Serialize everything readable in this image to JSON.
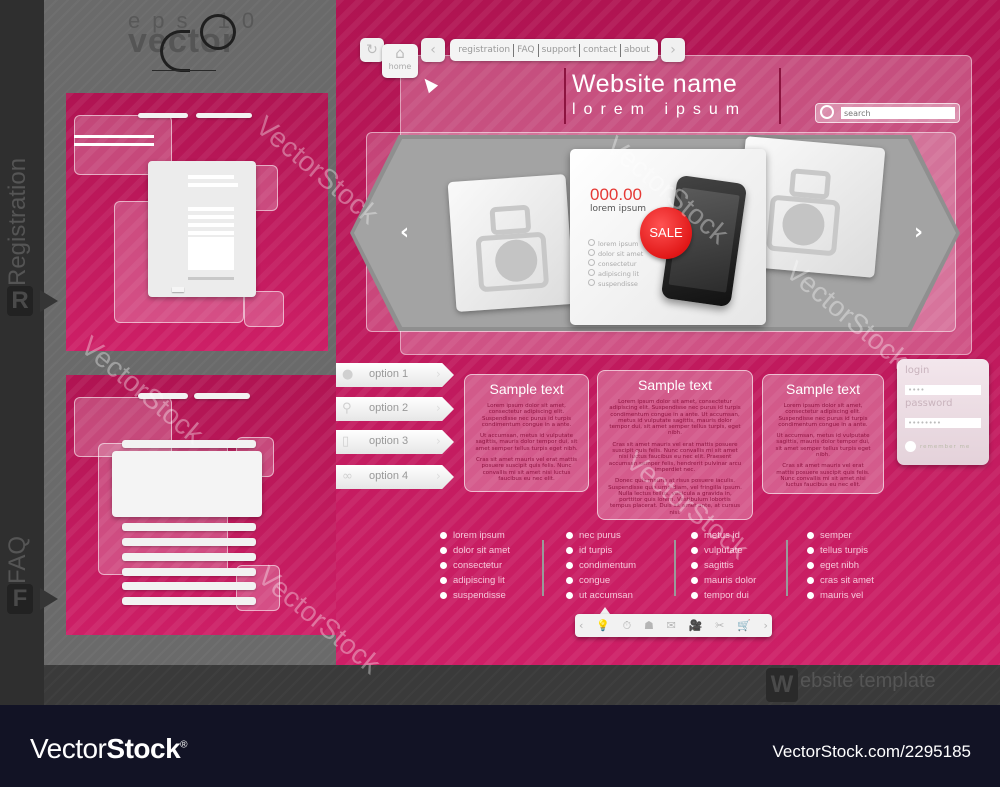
{
  "brand": {
    "eps_label": "eps 10",
    "vector_label": "vector"
  },
  "side_labels": {
    "registration": "Registration",
    "registration_initial": "R",
    "faq": "FAQ",
    "faq_initial": "F"
  },
  "nav": {
    "refresh_icon": "refresh-icon",
    "home_label": "home",
    "prev_icon": "chevron-left-icon",
    "next_icon": "chevron-right-icon",
    "links": [
      "registration",
      "FAQ",
      "support",
      "contact",
      "about"
    ]
  },
  "header": {
    "site_name": "Website name",
    "tagline": "lorem ipsum"
  },
  "search": {
    "placeholder": "search"
  },
  "slider": {
    "prev_label": "‹",
    "next_label": "›",
    "product": {
      "price": "000.00",
      "label": "lorem ipsum",
      "badge": "SALE",
      "features": [
        "lorem ipsum",
        "dolor sit amet",
        "consectetur",
        "adipiscing lit",
        "suspendisse"
      ]
    }
  },
  "options": [
    {
      "label": "option 1",
      "icon": "user-icon"
    },
    {
      "label": "option 2",
      "icon": "runner-icon"
    },
    {
      "label": "option 3",
      "icon": "phone-icon"
    },
    {
      "label": "option 4",
      "icon": "handshake-icon"
    }
  ],
  "sample_boxes": [
    {
      "title": "Sample text",
      "paragraphs": [
        "Lorem ipsum dolor sit amet, consectetur adipiscing elit. Suspendisse nec purus id turpis condimentum congue in a ante.",
        "Ut accumsan, metus id vulputate sagittis, mauris dolor tempor dui, sit amet semper tellus turpis eget nibh.",
        "Cras sit amet mauris vel erat mattis posuere suscipit quis felis. Nunc convallis mi sit amet nisi luctus faucibus eu nec elit."
      ]
    },
    {
      "title": "Sample text",
      "paragraphs": [
        "Lorem ipsum dolor sit amet, consectetur adipiscing elit. Suspendisse nec purus id turpis condimentum congue in a ante. Ut accumsan, metus id vulputate sagittis, mauris dolor tempor dui, sit amet semper tellus turpis, eget nibh.",
        "Cras sit amet mauris vel erat mattis posuere suscipit quis felis. Nunc convallis mi sit amet nisi luctus faucibus eu nec elit. Praesent accumsan semper felis, hendrerit pulvinar arcu imperdiet nec.",
        "Donec quis mauris at risus posuere iaculis. Suspendisse quis urna diam, vel fringilla ipsum. Nulla lectus tellus, vehicula a gravida in, porttitor quis lorem. Vestibulum lobortis tempus placerat. Duis sit amet ante, at cursus nisi."
      ]
    },
    {
      "title": "Sample text",
      "paragraphs": [
        "Lorem ipsum dolor sit amet, consectetur adipiscing elit. Suspendisse nec purus id turpis condimentum congue in a ante.",
        "Ut accumsan, metus id vulputate sagittis, mauris dolor tempor dui, sit amet semper tellus turpis eget nibh.",
        "Cras sit amet mauris vel erat mattis posuere suscipit quis felis. Nunc convallis mi sit amet nisi luctus faucibus eu nec elit."
      ]
    }
  ],
  "login": {
    "login_label": "login",
    "login_value": "••••",
    "password_label": "password",
    "password_value": "••••••••",
    "remember_label": "remember me"
  },
  "footer_lists": [
    [
      "lorem ipsum",
      "dolor sit amet",
      "consectetur",
      "adipiscing lit",
      "suspendisse"
    ],
    [
      "nec purus",
      "id turpis",
      "condimentum",
      "congue",
      "ut accumsan"
    ],
    [
      "metus id",
      "vulputate",
      "sagittis",
      "mauris dolor",
      "tempor dui"
    ],
    [
      "semper",
      "tellus turpis",
      "eget nibh",
      "cras sit amet",
      "mauris vel"
    ]
  ],
  "icon_bar": {
    "prev": "‹",
    "next": "›",
    "icons": [
      {
        "name": "bulb-icon",
        "glyph": "💡"
      },
      {
        "name": "stopwatch-icon",
        "glyph": "⏱"
      },
      {
        "name": "robot-icon",
        "glyph": "☗"
      },
      {
        "name": "envelope-icon",
        "glyph": "✉"
      },
      {
        "name": "camera-icon",
        "glyph": "🎥"
      },
      {
        "name": "tools-icon",
        "glyph": "✂"
      },
      {
        "name": "cart-icon",
        "glyph": "🛒"
      }
    ]
  },
  "template_label": {
    "initial": "W",
    "text": "ebsite template"
  },
  "watermark": "VectorStock",
  "footer": {
    "logo_light": "Vector",
    "logo_bold": "Stock",
    "logo_reg": "®",
    "image_id": "VectorStock.com/2295185"
  },
  "colors": {
    "brand_pink": "#c2185b",
    "price_red": "#e53935",
    "sale_red": "#d50000",
    "footer_navy": "#121325"
  }
}
